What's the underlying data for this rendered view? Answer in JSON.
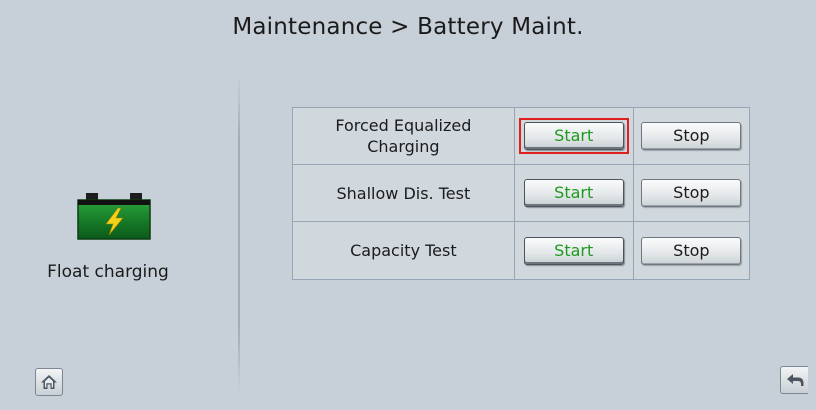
{
  "header": {
    "title": "Maintenance > Battery Maint."
  },
  "battery_status": {
    "icon": "battery-charging-icon",
    "label": "Float charging"
  },
  "maintenance_rows": [
    {
      "name": "Forced Equalized Charging",
      "start_label": "Start",
      "stop_label": "Stop",
      "start_highlighted": true
    },
    {
      "name": "Shallow Dis. Test",
      "start_label": "Start",
      "stop_label": "Stop",
      "start_highlighted": false
    },
    {
      "name": "Capacity Test",
      "start_label": "Start",
      "stop_label": "Stop",
      "start_highlighted": false
    }
  ],
  "nav": {
    "home_icon": "home-icon",
    "back_icon": "back-arrow-icon"
  },
  "colors": {
    "background": "#c7d0d8",
    "start_text": "#1e9a1e",
    "highlight": "#e0201f",
    "battery_green": "#1f8a2f",
    "bolt_yellow": "#f2d21a"
  }
}
